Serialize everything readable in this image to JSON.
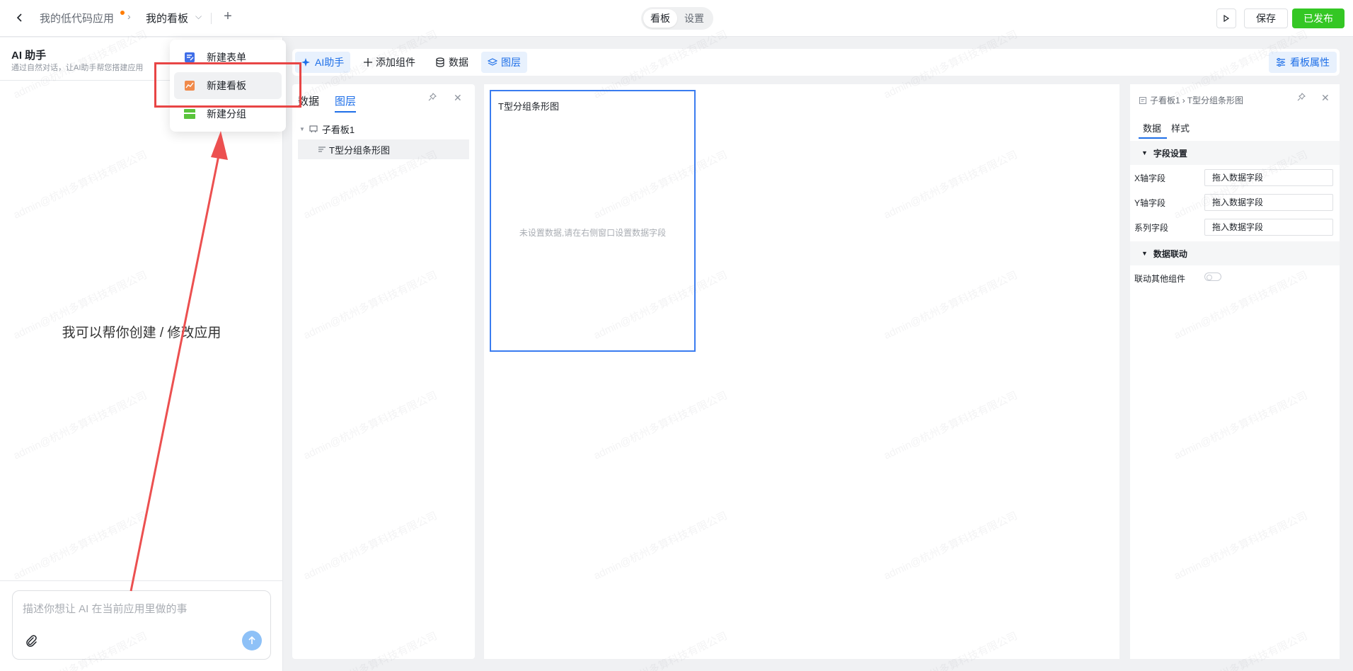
{
  "header": {
    "app_name": "我的低代码应用",
    "current_board": "我的看板",
    "mode_tabs": [
      "看板",
      "设置"
    ],
    "save_label": "保存",
    "publish_label": "已发布"
  },
  "ai": {
    "title": "AI 助手",
    "subtitle": "通过自然对话，让AI助手帮您搭建应用",
    "center_text": "我可以帮你创建 / 修改应用",
    "input_placeholder": "描述你想让 AI 在当前应用里做的事"
  },
  "dropdown": {
    "items": [
      {
        "label": "新建表单",
        "icon": "form-icon"
      },
      {
        "label": "新建看板",
        "icon": "dashboard-icon"
      },
      {
        "label": "新建分组",
        "icon": "group-icon"
      }
    ]
  },
  "toolbar": {
    "ai_label": "AI助手",
    "add_component_label": "添加组件",
    "data_label": "数据",
    "layer_label": "图层",
    "props_label": "看板属性"
  },
  "layer_panel": {
    "tabs": [
      "数据",
      "图层"
    ],
    "root_node": "子看板1",
    "child_node": "T型分组条形图"
  },
  "canvas": {
    "chart_title": "T型分组条形图",
    "empty_text": "未设置数据,请在右侧窗口设置数据字段"
  },
  "props": {
    "breadcrumb_parent": "子看板1",
    "breadcrumb_current": "T型分组条形图",
    "tabs": [
      "数据",
      "样式"
    ],
    "section_fields": "字段设置",
    "x_label": "X轴字段",
    "y_label": "Y轴字段",
    "series_label": "系列字段",
    "field_placeholder": "拖入数据字段",
    "section_link": "数据联动",
    "link_label": "联动其他组件"
  },
  "watermark": "admin@杭州多算科技有限公司",
  "colors": {
    "primary": "#1e6fe8",
    "publish": "#34c724",
    "highlight": "#e84545"
  }
}
